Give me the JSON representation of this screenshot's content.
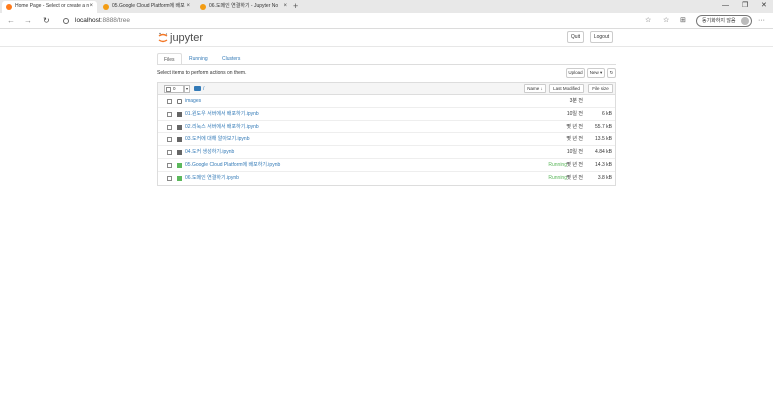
{
  "browser": {
    "tabs": [
      {
        "title": "Home Page - Select or create a n",
        "active": true,
        "favicon_color": "#ff7a1a"
      },
      {
        "title": "05.Google Cloud Platform에 배포",
        "active": false,
        "favicon_color": "#f39c12"
      },
      {
        "title": "06.도메인 연결하기 - Jupyter No",
        "active": false,
        "favicon_color": "#f39c12"
      }
    ],
    "tab_close": "×",
    "new_tab": "+",
    "window_controls": {
      "minimize": "—",
      "maximize": "❐",
      "close": "✕"
    },
    "address": {
      "host": "localhost",
      "path": ":8888/tree"
    },
    "nav": {
      "back": "←",
      "forward": "→",
      "reload": "↻"
    },
    "toolbar_icons": {
      "favorites": "☆",
      "collections": "☆",
      "extensions": "⊞",
      "more": "···"
    },
    "profile_label": "동기화하지 않음"
  },
  "jupyter": {
    "logo_text": "jupyter",
    "quit_label": "Quit",
    "logout_label": "Logout",
    "tabs": [
      {
        "label": "Files",
        "active": true
      },
      {
        "label": "Running",
        "active": false
      },
      {
        "label": "Clusters",
        "active": false
      }
    ],
    "hint": "Select items to perform actions on them.",
    "upload_label": "Upload",
    "new_label": "New ▾",
    "refresh_icon": "↻",
    "list_header": {
      "selected_count": "0",
      "caret": "▾",
      "crumb": "/",
      "name_label": "Name ↓",
      "last_modified_label": "Last Modified",
      "file_size_label": "File size"
    },
    "files": [
      {
        "type": "folder",
        "name": "images",
        "running": "",
        "modified": "3분 전",
        "size": ""
      },
      {
        "type": "notebook",
        "name": "01.윈도우 서버에서 배포하기.ipynb",
        "running": "",
        "modified": "10일 전",
        "size": "6 kB"
      },
      {
        "type": "notebook",
        "name": "02.리눅스 서버에서 배포하기.ipynb",
        "running": "",
        "modified": "몇 년 전",
        "size": "55.7 kB"
      },
      {
        "type": "notebook",
        "name": "03.도커에 대해 알아보기.ipynb",
        "running": "",
        "modified": "몇 년 전",
        "size": "13.5 kB"
      },
      {
        "type": "notebook",
        "name": "04.도커 생성하기.ipynb",
        "running": "",
        "modified": "10일 전",
        "size": "4.84 kB"
      },
      {
        "type": "notebook-running",
        "name": "05.Google Cloud Platform에 배포하기.ipynb",
        "running": "Running",
        "modified": "몇 년 전",
        "size": "14.3 kB"
      },
      {
        "type": "notebook-running",
        "name": "06.도메인 연결하기.ipynb",
        "running": "Running",
        "modified": "몇 년 전",
        "size": "3.8 kB"
      }
    ]
  }
}
